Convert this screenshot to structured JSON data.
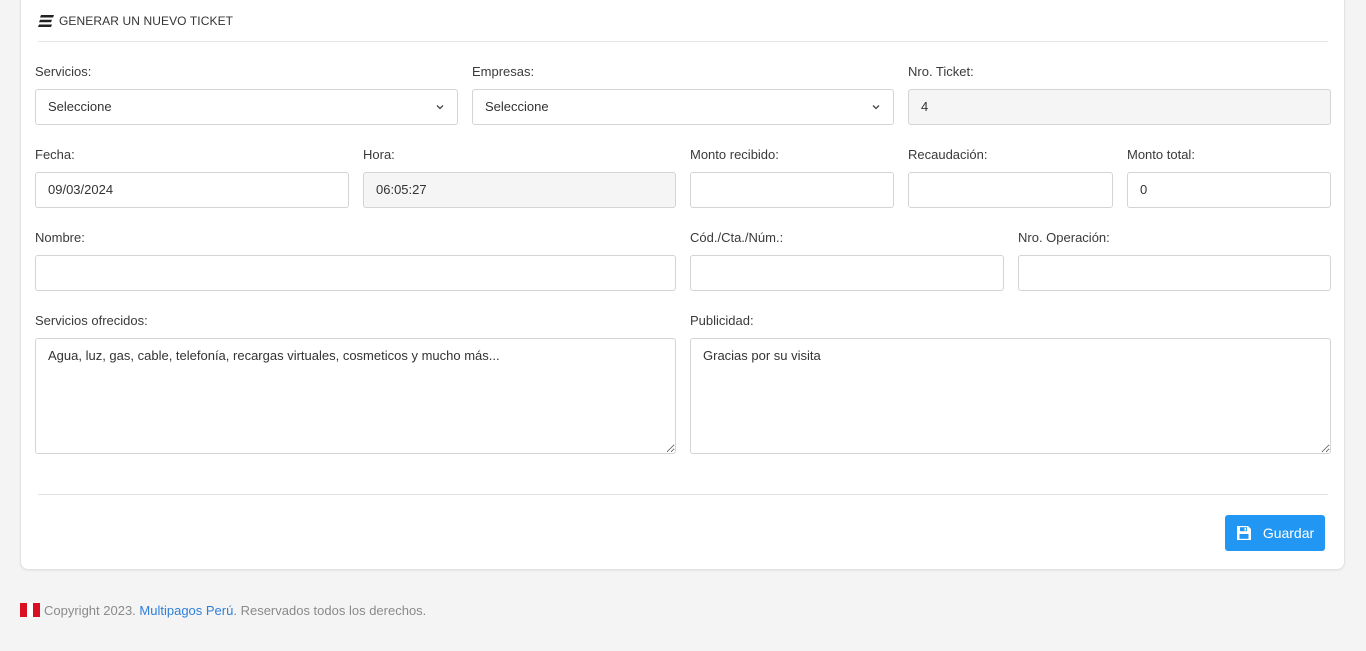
{
  "header": {
    "title": "GENERAR UN NUEVO TICKET",
    "icon": "hamburger-lines-icon"
  },
  "form": {
    "servicios": {
      "label": "Servicios:",
      "value": "Seleccione"
    },
    "empresas": {
      "label": "Empresas:",
      "value": "Seleccione"
    },
    "nro_ticket": {
      "label": "Nro. Ticket:",
      "value": "4"
    },
    "fecha": {
      "label": "Fecha:",
      "value": "09/03/2024"
    },
    "hora": {
      "label": "Hora:",
      "value": "06:05:27"
    },
    "monto_recibido": {
      "label": "Monto recibido:",
      "value": ""
    },
    "recaudacion": {
      "label": "Recaudación:",
      "value": ""
    },
    "monto_total": {
      "label": "Monto total:",
      "value": "0"
    },
    "nombre": {
      "label": "Nombre:",
      "value": ""
    },
    "cod_cta_num": {
      "label": "Cód./Cta./Núm.:",
      "value": ""
    },
    "nro_operacion": {
      "label": "Nro. Operación:",
      "value": ""
    },
    "servicios_ofrecidos": {
      "label": "Servicios ofrecidos:",
      "value": "Agua, luz, gas, cable, telefonía, recargas virtuales, cosmeticos y mucho más..."
    },
    "publicidad": {
      "label": "Publicidad:",
      "value": "Gracias por su visita"
    }
  },
  "actions": {
    "save_label": "Guardar",
    "save_icon": "floppy-disk-icon",
    "accent_color": "#2196f3"
  },
  "footer": {
    "prefix": "Copyright 2023.",
    "brand": "Multipagos Perú",
    "suffix": ". Reservados todos los derechos.",
    "flag_icon": "peru-flag-icon",
    "link_color": "#2e7fd8"
  }
}
